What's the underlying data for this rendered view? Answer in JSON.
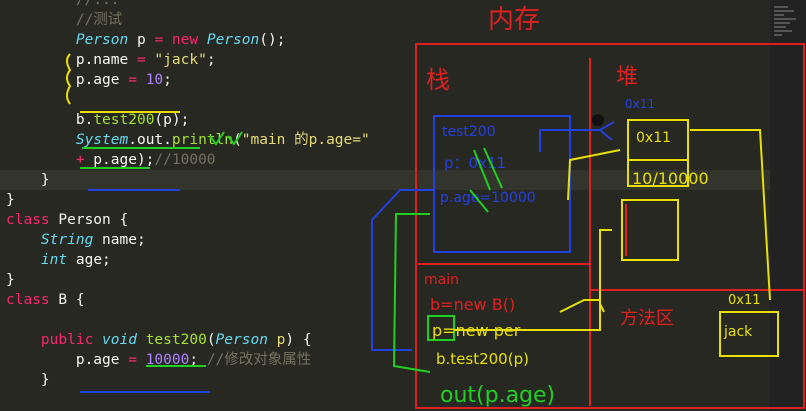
{
  "code_lines": [
    {
      "tokens": [
        {
          "t": "        ",
          "c": "pl"
        },
        {
          "t": "//",
          "c": "cm"
        },
        {
          "t": "...",
          "c": "cm"
        }
      ]
    },
    {
      "tokens": [
        {
          "t": "        ",
          "c": "pl"
        },
        {
          "t": "//测试",
          "c": "cm"
        }
      ]
    },
    {
      "tokens": [
        {
          "t": "        ",
          "c": "pl"
        },
        {
          "t": "Person",
          "c": "ty"
        },
        {
          "t": " p ",
          "c": "pl"
        },
        {
          "t": "=",
          "c": "kw"
        },
        {
          "t": " ",
          "c": "pl"
        },
        {
          "t": "new",
          "c": "kw"
        },
        {
          "t": " ",
          "c": "pl"
        },
        {
          "t": "Person",
          "c": "ty"
        },
        {
          "t": "();",
          "c": "pl"
        }
      ]
    },
    {
      "tokens": [
        {
          "t": "        ",
          "c": "pl"
        },
        {
          "t": "p.name ",
          "c": "pl"
        },
        {
          "t": "=",
          "c": "kw"
        },
        {
          "t": " ",
          "c": "pl"
        },
        {
          "t": "\"jack\"",
          "c": "str"
        },
        {
          "t": ";",
          "c": "pl"
        }
      ]
    },
    {
      "tokens": [
        {
          "t": "        ",
          "c": "pl"
        },
        {
          "t": "p.age ",
          "c": "pl"
        },
        {
          "t": "=",
          "c": "kw"
        },
        {
          "t": " ",
          "c": "pl"
        },
        {
          "t": "10",
          "c": "num"
        },
        {
          "t": ";",
          "c": "pl"
        }
      ]
    },
    {
      "tokens": []
    },
    {
      "tokens": [
        {
          "t": "        ",
          "c": "pl"
        },
        {
          "t": "b.",
          "c": "pl"
        },
        {
          "t": "test200",
          "c": "fn"
        },
        {
          "t": "(p);",
          "c": "pl"
        }
      ]
    },
    {
      "tokens": [
        {
          "t": "        ",
          "c": "pl"
        },
        {
          "t": "System",
          "c": "ty"
        },
        {
          "t": ".out.",
          "c": "pl"
        },
        {
          "t": "println",
          "c": "fn"
        },
        {
          "t": "(",
          "c": "pl"
        },
        {
          "t": "\"main 的p.age=\"",
          "c": "str"
        }
      ]
    },
    {
      "tokens": [
        {
          "t": "        ",
          "c": "pl"
        },
        {
          "t": "+",
          "c": "kw"
        },
        {
          "t": " p.age);",
          "c": "pl"
        },
        {
          "t": "//10000",
          "c": "cm"
        }
      ]
    },
    {
      "tokens": [
        {
          "t": "    }",
          "c": "pl"
        }
      ]
    },
    {
      "tokens": [
        {
          "t": "}",
          "c": "pl"
        }
      ]
    },
    {
      "tokens": [
        {
          "t": "class",
          "c": "kw"
        },
        {
          "t": " Person {",
          "c": "pl"
        }
      ]
    },
    {
      "tokens": [
        {
          "t": "    ",
          "c": "pl"
        },
        {
          "t": "String",
          "c": "ty"
        },
        {
          "t": " name;",
          "c": "pl"
        }
      ]
    },
    {
      "tokens": [
        {
          "t": "    ",
          "c": "pl"
        },
        {
          "t": "int",
          "c": "ty"
        },
        {
          "t": " age;",
          "c": "pl"
        }
      ]
    },
    {
      "tokens": [
        {
          "t": "}",
          "c": "pl"
        }
      ]
    },
    {
      "tokens": [
        {
          "t": "class",
          "c": "kw"
        },
        {
          "t": " B {",
          "c": "pl"
        }
      ]
    },
    {
      "tokens": []
    },
    {
      "tokens": [
        {
          "t": "    ",
          "c": "pl"
        },
        {
          "t": "public",
          "c": "kw"
        },
        {
          "t": " ",
          "c": "pl"
        },
        {
          "t": "void",
          "c": "ty"
        },
        {
          "t": " ",
          "c": "pl"
        },
        {
          "t": "test200",
          "c": "fn"
        },
        {
          "t": "(",
          "c": "pl"
        },
        {
          "t": "Person",
          "c": "ty"
        },
        {
          "t": " ",
          "c": "pl"
        },
        {
          "t": "p",
          "c": "str"
        },
        {
          "t": ") {",
          "c": "pl"
        }
      ]
    },
    {
      "tokens": [
        {
          "t": "        ",
          "c": "pl"
        },
        {
          "t": "p.age ",
          "c": "pl"
        },
        {
          "t": "=",
          "c": "kw"
        },
        {
          "t": " ",
          "c": "pl"
        },
        {
          "t": "10000",
          "c": "num"
        },
        {
          "t": "; ",
          "c": "pl"
        },
        {
          "t": "//修改对象属性",
          "c": "cm"
        }
      ]
    },
    {
      "tokens": [
        {
          "t": "    }",
          "c": "pl"
        }
      ]
    }
  ],
  "annotations": {
    "memory_title": "内存",
    "stack_label": "栈",
    "heap_label": "堆",
    "heap_addr": "0x11",
    "heap_obj_addr": "0x11",
    "heap_obj_value": "10/10000",
    "method_area_label": "方法区",
    "method_obj_addr": "0x11",
    "method_obj_value": "jack",
    "test200_frame": "test200",
    "test200_p": "p：0x11",
    "test200_page": "p.age=10000",
    "main_frame": "main",
    "main_b": "b=new B()",
    "main_p": "p=new per",
    "main_call": "b.test200(p)",
    "out_text": "out(p.age)"
  },
  "colors": {
    "bg": "#272822",
    "red": "#e02020",
    "blue": "#2340e0",
    "yellow": "#e8e000",
    "green": "#20d020"
  }
}
